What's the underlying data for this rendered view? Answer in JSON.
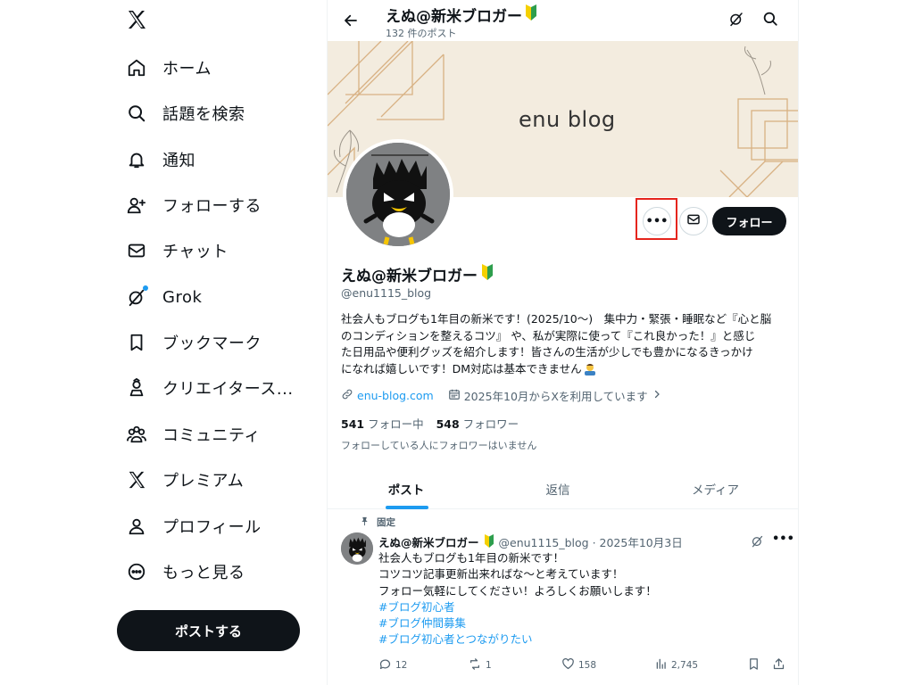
{
  "sidebar": {
    "items": [
      {
        "label": "ホーム",
        "icon": "home-icon"
      },
      {
        "label": "話題を検索",
        "icon": "search-icon"
      },
      {
        "label": "通知",
        "icon": "bell-icon"
      },
      {
        "label": "フォローする",
        "icon": "person-add-icon"
      },
      {
        "label": "チャット",
        "icon": "envelope-icon"
      },
      {
        "label": "Grok",
        "icon": "grok-icon"
      },
      {
        "label": "ブックマーク",
        "icon": "bookmark-icon"
      },
      {
        "label": "クリエイタース...",
        "icon": "creator-icon"
      },
      {
        "label": "コミュニティ",
        "icon": "community-icon"
      },
      {
        "label": "プレミアム",
        "icon": "x-icon"
      },
      {
        "label": "プロフィール",
        "icon": "profile-icon"
      },
      {
        "label": "もっと見る",
        "icon": "more-circle-icon"
      }
    ],
    "post_button": "ポストする"
  },
  "header": {
    "title": "えぬ@新米ブロガー",
    "post_count": "132 件のポスト"
  },
  "banner": {
    "text": "enu blog"
  },
  "profile": {
    "follow_button": "フォロー",
    "display_name": "えぬ@新米ブロガー",
    "handle": "@enu1115_blog",
    "bio_lines": [
      "社会人もブログも1年目の新米です！(2025/10〜)　集中力・緊張・睡眠など『心と脳",
      "のコンディションを整えるコツ』 や、私が実際に使って『これ良かった！』と感じ",
      "た日用品や便利グッズを紹介します！皆さんの生活が少しでも豊かになるきっかけ",
      "になれば嬉しいです！DM対応は基本できません"
    ],
    "website": "enu-blog.com",
    "joined": "2025年10月からXを利用しています",
    "following_count": "541",
    "following_label": "フォロー中",
    "followers_count": "548",
    "followers_label": "フォロワー",
    "mutual_note": "フォローしている人にフォロワーはいません"
  },
  "tabs": [
    {
      "label": "ポスト",
      "active": true
    },
    {
      "label": "返信",
      "active": false
    },
    {
      "label": "メディア",
      "active": false
    }
  ],
  "pinned_post": {
    "pinned_label": "固定",
    "author_name": "えぬ@新米ブロガー",
    "meta": "@enu1115_blog · 2025年10月3日",
    "lines": [
      "社会人もブログも1年目の新米です！",
      "コツコツ記事更新出来ればな〜と考えています！",
      "フォロー気軽にしてください！よろしくお願いします！"
    ],
    "hashtags": [
      "#ブログ初心者",
      "#ブログ仲間募集",
      "#ブログ初心者とつながりたい"
    ],
    "replies": "12",
    "reposts": "1",
    "likes": "158",
    "views": "2,745"
  },
  "colors": {
    "accent": "#1d9bf0",
    "text": "#0f1419",
    "secondary_text": "#536471",
    "banner_bg": "#f3ecdf",
    "highlight_box": "#e5251d"
  }
}
